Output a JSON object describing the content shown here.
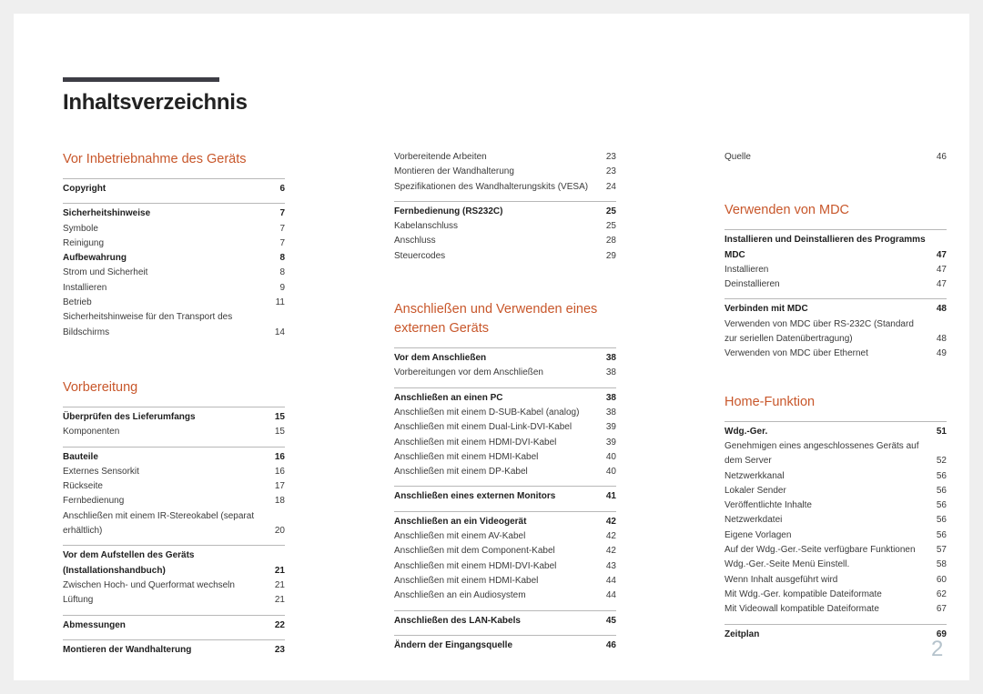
{
  "page_title": "Inhaltsverzeichnis",
  "page_number": "2",
  "accent_color": "#c8572b",
  "columns": [
    {
      "sections": [
        {
          "title": "Vor Inbetriebnahme des Geräts",
          "groups": [
            {
              "entries": [
                {
                  "label": "Copyright",
                  "page": "6",
                  "bold": true
                }
              ]
            },
            {
              "entries": [
                {
                  "label": "Sicherheitshinweise",
                  "page": "7",
                  "bold": true
                },
                {
                  "label": "Symbole",
                  "page": "7",
                  "bold": false
                },
                {
                  "label": "Reinigung",
                  "page": "7",
                  "bold": false
                },
                {
                  "label": "Aufbewahrung",
                  "page": "8",
                  "bold": true
                },
                {
                  "label": "Strom und Sicherheit",
                  "page": "8",
                  "bold": false
                },
                {
                  "label": "Installieren",
                  "page": "9",
                  "bold": false
                },
                {
                  "label": "Betrieb",
                  "page": "11",
                  "bold": false
                },
                {
                  "label": "Sicherheitshinweise für den Transport des Bildschirms",
                  "page": "14",
                  "bold": false
                }
              ]
            }
          ]
        },
        {
          "title": "Vorbereitung",
          "groups": [
            {
              "entries": [
                {
                  "label": "Überprüfen des Lieferumfangs",
                  "page": "15",
                  "bold": true
                },
                {
                  "label": "Komponenten",
                  "page": "15",
                  "bold": false
                }
              ]
            },
            {
              "entries": [
                {
                  "label": "Bauteile",
                  "page": "16",
                  "bold": true
                },
                {
                  "label": "Externes Sensorkit",
                  "page": "16",
                  "bold": false
                },
                {
                  "label": "Rückseite",
                  "page": "17",
                  "bold": false
                },
                {
                  "label": "Fernbedienung",
                  "page": "18",
                  "bold": false
                },
                {
                  "label": "Anschließen mit einem IR-Stereokabel (separat erhältlich)",
                  "page": "20",
                  "bold": false
                }
              ]
            },
            {
              "entries": [
                {
                  "label": "Vor dem Aufstellen des Geräts (Installationshandbuch)",
                  "page": "21",
                  "bold": true
                },
                {
                  "label": "Zwischen Hoch- und Querformat wechseln",
                  "page": "21",
                  "bold": false
                },
                {
                  "label": "Lüftung",
                  "page": "21",
                  "bold": false
                }
              ]
            },
            {
              "entries": [
                {
                  "label": "Abmessungen",
                  "page": "22",
                  "bold": true
                }
              ]
            },
            {
              "entries": [
                {
                  "label": "Montieren der Wandhalterung",
                  "page": "23",
                  "bold": true
                }
              ]
            }
          ]
        }
      ]
    },
    {
      "sections": [
        {
          "title": "",
          "groups": [
            {
              "entries": [
                {
                  "label": "Vorbereitende Arbeiten",
                  "page": "23",
                  "bold": false
                },
                {
                  "label": "Montieren der Wandhalterung",
                  "page": "23",
                  "bold": false
                },
                {
                  "label": "Spezifikationen des Wandhalterungskits (VESA)",
                  "page": "24",
                  "bold": false
                }
              ]
            },
            {
              "entries": [
                {
                  "label": "Fernbedienung (RS232C)",
                  "page": "25",
                  "bold": true
                },
                {
                  "label": "Kabelanschluss",
                  "page": "25",
                  "bold": false
                },
                {
                  "label": "Anschluss",
                  "page": "28",
                  "bold": false
                },
                {
                  "label": "Steuercodes",
                  "page": "29",
                  "bold": false
                }
              ]
            }
          ]
        },
        {
          "title": "Anschließen und Verwenden eines externen Geräts",
          "groups": [
            {
              "entries": [
                {
                  "label": "Vor dem Anschließen",
                  "page": "38",
                  "bold": true
                },
                {
                  "label": "Vorbereitungen vor dem Anschließen",
                  "page": "38",
                  "bold": false
                }
              ]
            },
            {
              "entries": [
                {
                  "label": "Anschließen an einen PC",
                  "page": "38",
                  "bold": true
                },
                {
                  "label": "Anschließen mit einem D-SUB-Kabel (analog)",
                  "page": "38",
                  "bold": false
                },
                {
                  "label": "Anschließen mit einem Dual-Link-DVI-Kabel",
                  "page": "39",
                  "bold": false
                },
                {
                  "label": "Anschließen mit einem HDMI-DVI-Kabel",
                  "page": "39",
                  "bold": false
                },
                {
                  "label": "Anschließen mit einem HDMI-Kabel",
                  "page": "40",
                  "bold": false
                },
                {
                  "label": "Anschließen mit einem DP-Kabel",
                  "page": "40",
                  "bold": false
                }
              ]
            },
            {
              "entries": [
                {
                  "label": "Anschließen eines externen Monitors",
                  "page": "41",
                  "bold": true
                }
              ]
            },
            {
              "entries": [
                {
                  "label": "Anschließen an ein Videogerät",
                  "page": "42",
                  "bold": true
                },
                {
                  "label": "Anschließen mit einem AV-Kabel",
                  "page": "42",
                  "bold": false
                },
                {
                  "label": "Anschließen mit dem Component-Kabel",
                  "page": "42",
                  "bold": false
                },
                {
                  "label": "Anschließen mit einem HDMI-DVI-Kabel",
                  "page": "43",
                  "bold": false
                },
                {
                  "label": "Anschließen mit einem HDMI-Kabel",
                  "page": "44",
                  "bold": false
                },
                {
                  "label": "Anschließen an ein Audiosystem",
                  "page": "44",
                  "bold": false
                }
              ]
            },
            {
              "entries": [
                {
                  "label": "Anschließen des LAN-Kabels",
                  "page": "45",
                  "bold": true
                }
              ]
            },
            {
              "entries": [
                {
                  "label": "Ändern der Eingangsquelle",
                  "page": "46",
                  "bold": true
                }
              ]
            }
          ]
        }
      ]
    },
    {
      "sections": [
        {
          "title": "",
          "groups": [
            {
              "entries": [
                {
                  "label": "Quelle",
                  "page": "46",
                  "bold": false
                }
              ]
            }
          ]
        },
        {
          "title": "Verwenden von MDC",
          "groups": [
            {
              "entries": [
                {
                  "label": "Installieren und Deinstallieren des Programms MDC",
                  "page": "47",
                  "bold": true
                },
                {
                  "label": "Installieren",
                  "page": "47",
                  "bold": false
                },
                {
                  "label": "Deinstallieren",
                  "page": "47",
                  "bold": false
                }
              ]
            },
            {
              "entries": [
                {
                  "label": "Verbinden mit MDC",
                  "page": "48",
                  "bold": true
                },
                {
                  "label": "Verwenden von MDC über RS-232C (Standard zur seriellen Datenübertragung)",
                  "page": "48",
                  "bold": false
                },
                {
                  "label": "Verwenden von MDC über Ethernet",
                  "page": "49",
                  "bold": false
                }
              ]
            }
          ]
        },
        {
          "title": "Home-Funktion",
          "groups": [
            {
              "entries": [
                {
                  "label": "Wdg.-Ger.",
                  "page": "51",
                  "bold": true
                },
                {
                  "label": "Genehmigen eines angeschlossenes Geräts auf dem Server",
                  "page": "52",
                  "bold": false
                },
                {
                  "label": "Netzwerkkanal",
                  "page": "56",
                  "bold": false
                },
                {
                  "label": "Lokaler Sender",
                  "page": "56",
                  "bold": false
                },
                {
                  "label": "Veröffentlichte Inhalte",
                  "page": "56",
                  "bold": false
                },
                {
                  "label": "Netzwerkdatei",
                  "page": "56",
                  "bold": false
                },
                {
                  "label": "Eigene Vorlagen",
                  "page": "56",
                  "bold": false
                },
                {
                  "label": "Auf der Wdg.-Ger.-Seite verfügbare Funktionen",
                  "page": "57",
                  "bold": false
                },
                {
                  "label": "Wdg.-Ger.-Seite Menü Einstell.",
                  "page": "58",
                  "bold": false
                },
                {
                  "label": "Wenn Inhalt ausgeführt wird",
                  "page": "60",
                  "bold": false
                },
                {
                  "label": "Mit Wdg.-Ger. kompatible Dateiformate",
                  "page": "62",
                  "bold": false
                },
                {
                  "label": "Mit Videowall kompatible Dateiformate",
                  "page": "67",
                  "bold": false
                }
              ]
            },
            {
              "entries": [
                {
                  "label": "Zeitplan",
                  "page": "69",
                  "bold": true
                }
              ]
            }
          ]
        }
      ]
    }
  ]
}
